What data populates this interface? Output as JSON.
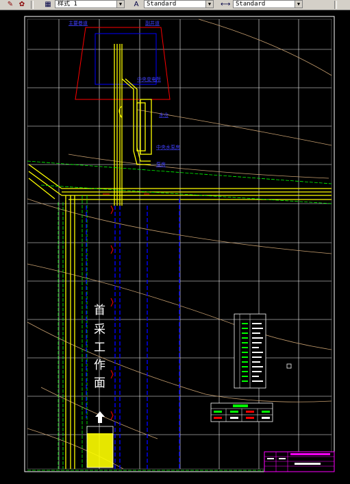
{
  "toolbar": {
    "style_combo": "样式 1",
    "text_style_combo": "Standard",
    "dim_style_combo": "Standard"
  },
  "drawing": {
    "labels": {
      "top_left_callout": "主要巷道",
      "top_right_callout": "副井道",
      "callout_1": "中央变电所",
      "callout_2": "水仓",
      "callout_3": "中央水泵房",
      "callout_4": "泵房"
    },
    "workface_text": [
      "首",
      "采",
      "工",
      "作",
      "面"
    ],
    "colors": {
      "grid": "#ffffff",
      "roadway": "#ffff00",
      "conveyor": "#00ff00",
      "blue_line": "#0000ff",
      "contour": "#c8a070",
      "red": "#ff0000",
      "magenta": "#ff00ff"
    }
  }
}
